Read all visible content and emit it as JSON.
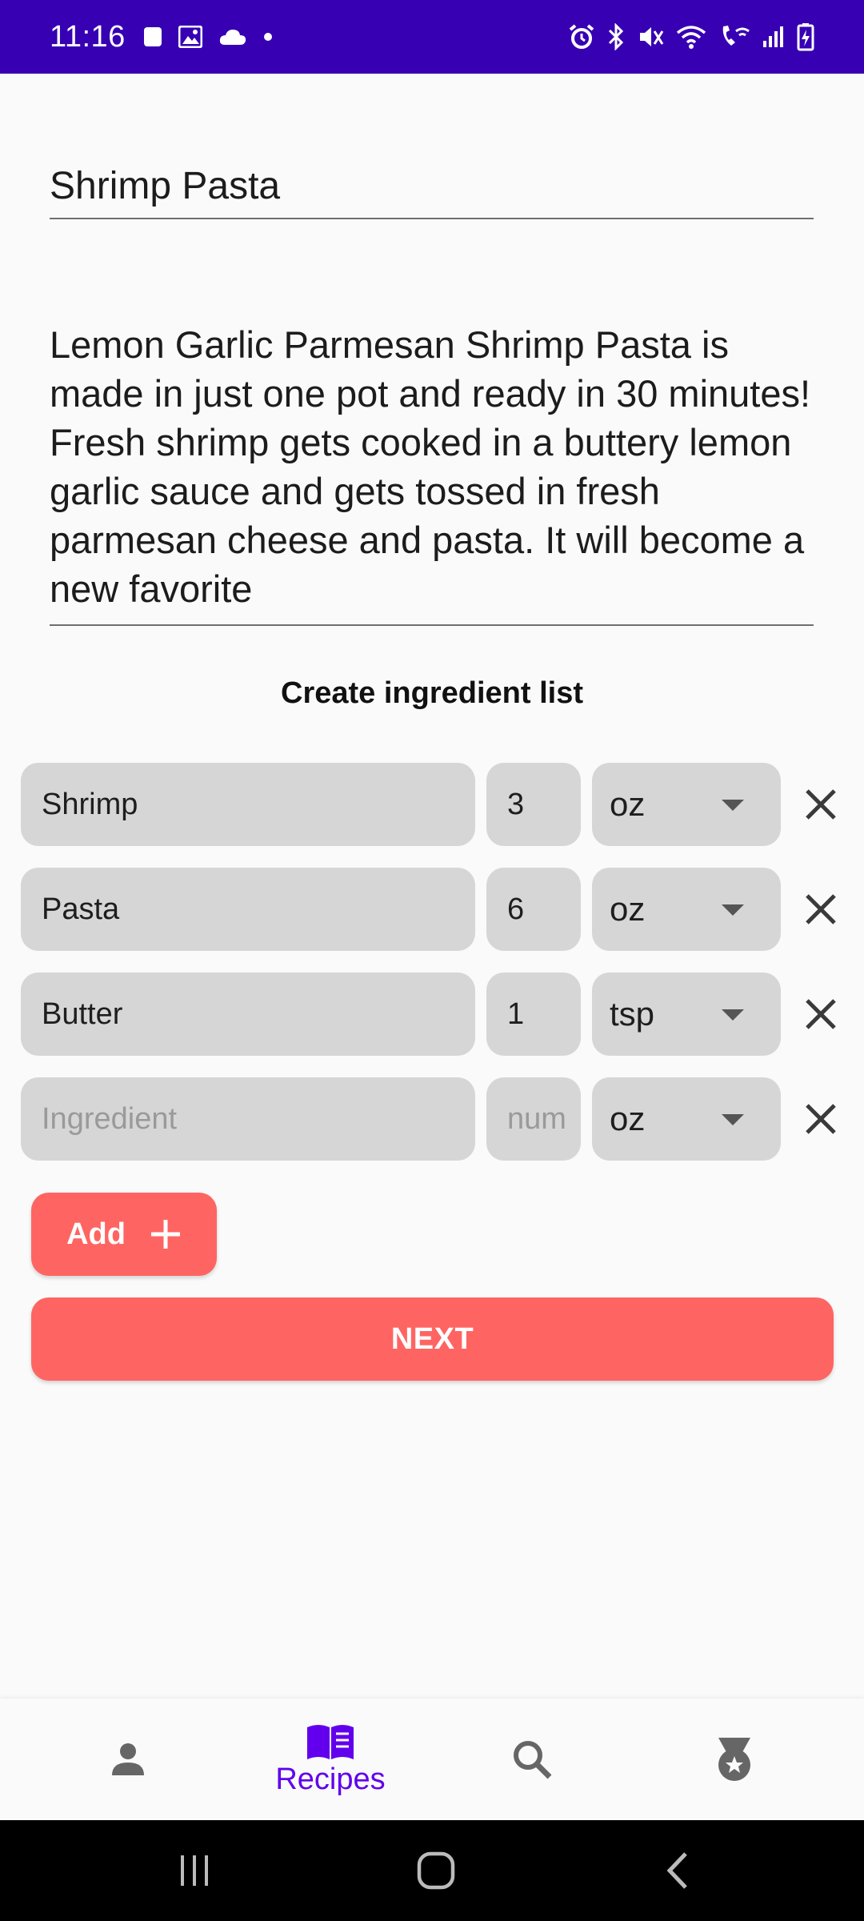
{
  "status_bar": {
    "time": "11:16",
    "background": "#3700b3",
    "left_icons": [
      "stop-icon",
      "image-icon",
      "cloud-icon",
      "dot-icon"
    ],
    "right_icons": [
      "alarm-icon",
      "bluetooth-icon",
      "mute-icon",
      "wifi-icon",
      "wifi-call-icon",
      "signal-icon",
      "battery-charging-icon"
    ]
  },
  "recipe": {
    "title": "Shrimp Pasta",
    "description": "Lemon Garlic Parmesan Shrimp Pasta is made in just one pot and ready in 30 minutes! Fresh shrimp gets cooked in a buttery lemon garlic sauce and gets tossed in fresh parmesan cheese and pasta. It will become a new favorite"
  },
  "ingredients": {
    "section_title": "Create ingredient list",
    "rows": [
      {
        "name": "Shrimp",
        "amount": "3",
        "unit": "oz"
      },
      {
        "name": "Pasta",
        "amount": "6",
        "unit": "oz"
      },
      {
        "name": "Butter",
        "amount": "1",
        "unit": "tsp"
      }
    ],
    "new_row": {
      "name_placeholder": "Ingredient",
      "amount_placeholder": "num",
      "unit": "oz"
    }
  },
  "buttons": {
    "add_label": "Add",
    "next_label": "NEXT",
    "accent_color": "#fe6562"
  },
  "bottom_nav": {
    "items": [
      {
        "icon": "person-icon",
        "label": ""
      },
      {
        "icon": "book-icon",
        "label": "Recipes",
        "active": true
      },
      {
        "icon": "search-icon",
        "label": ""
      },
      {
        "icon": "medal-icon",
        "label": ""
      }
    ],
    "active_color": "#6200ee"
  },
  "system_nav": [
    "recent-apps-icon",
    "home-icon",
    "back-icon"
  ]
}
